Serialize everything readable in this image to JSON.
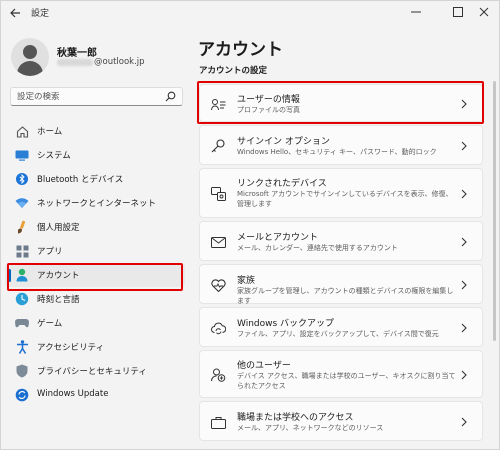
{
  "window": {
    "title": "設定",
    "controls": [
      "minimize",
      "maximize",
      "close"
    ]
  },
  "profile": {
    "name": "秋葉一郎",
    "email_visible": "@outlook.jp"
  },
  "search": {
    "placeholder": "設定の検索"
  },
  "sidebar": {
    "items": [
      {
        "label": "ホーム",
        "icon": "home-icon"
      },
      {
        "label": "システム",
        "icon": "system-icon"
      },
      {
        "label": "Bluetooth とデバイス",
        "icon": "bluetooth-icon"
      },
      {
        "label": "ネットワークとインターネット",
        "icon": "network-icon"
      },
      {
        "label": "個人用設定",
        "icon": "brush-icon"
      },
      {
        "label": "アプリ",
        "icon": "apps-icon"
      },
      {
        "label": "アカウント",
        "icon": "account-icon",
        "active": true
      },
      {
        "label": "時刻と言語",
        "icon": "time-language-icon"
      },
      {
        "label": "ゲーム",
        "icon": "game-icon"
      },
      {
        "label": "アクセシビリティ",
        "icon": "accessibility-icon"
      },
      {
        "label": "プライバシーとセキュリティ",
        "icon": "shield-icon"
      },
      {
        "label": "Windows Update",
        "icon": "update-icon"
      }
    ]
  },
  "main": {
    "title": "アカウント",
    "section": "アカウントの設定",
    "cards": [
      {
        "title": "ユーザーの情報",
        "sub": "プロファイルの写真",
        "icon": "user-info-icon"
      },
      {
        "title": "サインイン オプション",
        "sub": "Windows Hello、セキュリティ キー、パスワード、動的ロック",
        "icon": "key-icon"
      },
      {
        "title": "リンクされたデバイス",
        "sub": "Microsoft アカウントでサインインしているデバイスを表示、修復、管理します",
        "icon": "linked-devices-icon"
      },
      {
        "title": "メールとアカウント",
        "sub": "メール、カレンダー、連絡先で使用するアカウント",
        "icon": "mail-icon"
      },
      {
        "title": "家族",
        "sub": "家族グループを管理し、アカウントの種類とデバイスの権限を編集します",
        "icon": "family-heart-icon"
      },
      {
        "title": "Windows バックアップ",
        "sub": "ファイル、アプリ、設定をバックアップして、デバイス間で復元",
        "icon": "backup-icon"
      },
      {
        "title": "他のユーザー",
        "sub": "デバイス アクセス、職場または学校のユーザー、キオスクに割り当てられたアクセス",
        "icon": "other-users-icon"
      },
      {
        "title": "職場または学校へのアクセス",
        "sub": "メール、アプリ、ネットワークなどのリソース",
        "icon": "briefcase-icon"
      }
    ]
  },
  "colors": {
    "accent": "#0067c0",
    "highlight": "#e00000",
    "background": "#f3f3f3",
    "card": "#fbfbfb"
  }
}
